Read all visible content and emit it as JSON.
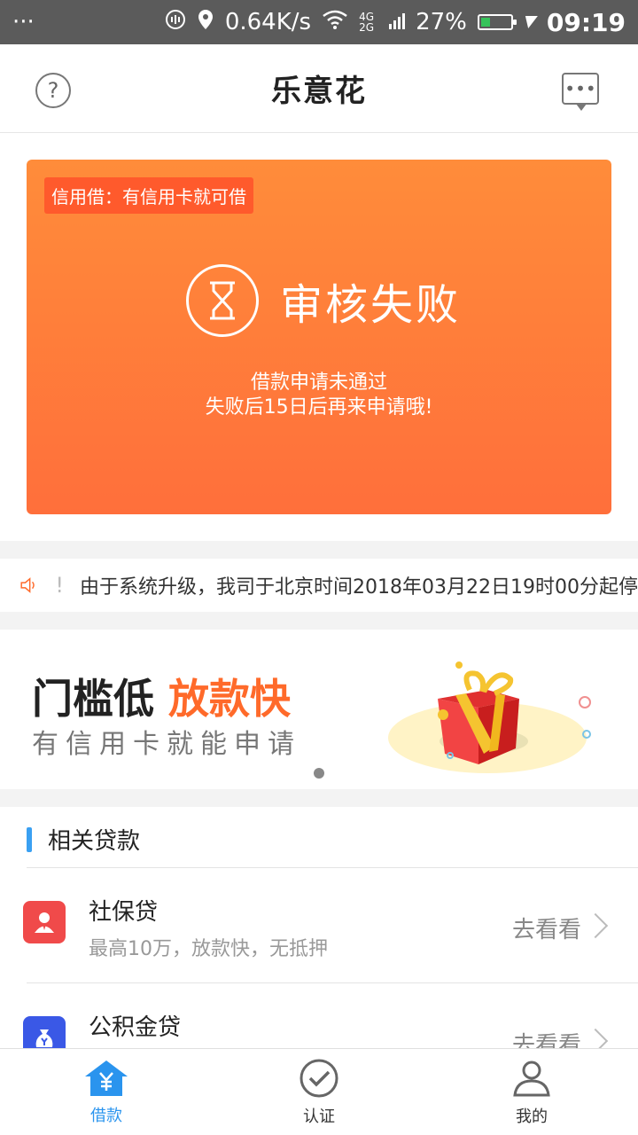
{
  "statusbar": {
    "dots": "···",
    "speed": "0.64K/s",
    "network": "4G 2G",
    "battery": "27%",
    "time": "09:19"
  },
  "header": {
    "title": "乐意花",
    "help_icon": "question-icon",
    "message_icon": "chat-icon"
  },
  "card": {
    "tag": "信用借：有信用卡就可借",
    "status": "审核失败",
    "desc_line1": "借款申请未通过",
    "desc_line2": "失败后15日后再来申请哦!",
    "colors": {
      "start": "#ff8c3a",
      "end": "#ff6f3b",
      "tag_bg": "#ff5a2c"
    }
  },
  "notice": {
    "text": "由于系统升级，我司于北京时间2018年03月22日19时00分起停"
  },
  "banner": {
    "title_main": "门槛低",
    "title_accent": "放款快",
    "subtitle": "有信用卡就能申请",
    "accent_color": "#ff6a2a"
  },
  "related": {
    "title": "相关贷款",
    "items": [
      {
        "name": "社保贷",
        "desc": "最高10万，放款快，无抵押",
        "action": "去看看",
        "icon": "person-icon",
        "color": "#f04a4a"
      },
      {
        "name": "公积金贷",
        "desc": "",
        "action": "去看看",
        "icon": "money-bag-icon",
        "color": "#3a58e6"
      }
    ]
  },
  "nav": {
    "items": [
      {
        "label": "借款",
        "icon": "home-yuan-icon",
        "active": true
      },
      {
        "label": "认证",
        "icon": "check-circle-icon",
        "active": false
      },
      {
        "label": "我的",
        "icon": "user-icon",
        "active": false
      }
    ],
    "active_color": "#2a94ee"
  }
}
